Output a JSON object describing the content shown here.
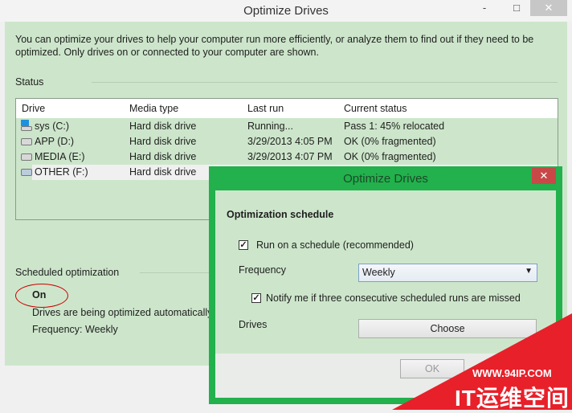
{
  "window": {
    "title": "Optimize Drives",
    "minimize": "-",
    "maximize": "□",
    "close": "✕"
  },
  "description": "You can optimize your drives to help your computer run more efficiently, or analyze them to find out if they need to be optimized. Only drives on or connected to your computer are shown.",
  "status_label": "Status",
  "columns": [
    "Drive",
    "Media type",
    "Last run",
    "Current status"
  ],
  "drives": [
    {
      "name": "sys (C:)",
      "media": "Hard disk drive",
      "last_run": "Running...",
      "status": "Pass 1: 45% relocated",
      "icon": "windows-drive-icon"
    },
    {
      "name": "APP (D:)",
      "media": "Hard disk drive",
      "last_run": "3/29/2013 4:05 PM",
      "status": "OK (0% fragmented)",
      "icon": "drive-icon"
    },
    {
      "name": "MEDIA (E:)",
      "media": "Hard disk drive",
      "last_run": "3/29/2013 4:07 PM",
      "status": "OK (0% fragmented)",
      "icon": "drive-icon"
    },
    {
      "name": "OTHER (F:)",
      "media": "Hard disk drive",
      "last_run": "",
      "status": "",
      "icon": "drive-icon"
    }
  ],
  "scheduled": {
    "label": "Scheduled optimization",
    "state": "On",
    "info": "Drives are being optimized automatically.",
    "frequency": "Frequency: Weekly"
  },
  "dialog": {
    "title": "Optimize Drives",
    "close": "✕",
    "heading": "Optimization schedule",
    "run_on_schedule": {
      "label": "Run on a schedule (recommended)",
      "checked": true
    },
    "frequency_label": "Frequency",
    "frequency_value": "Weekly",
    "notify": {
      "label": "Notify me if three consecutive scheduled runs are missed",
      "checked": true
    },
    "drives_label": "Drives",
    "choose_button": "Choose",
    "ok_button": "OK"
  },
  "watermark": {
    "url": "WWW.94IP.COM",
    "name": "IT运维空间",
    "color": "#e8202a"
  },
  "colors": {
    "accent": "#22b14c",
    "content_bg": "#cde6cb"
  }
}
